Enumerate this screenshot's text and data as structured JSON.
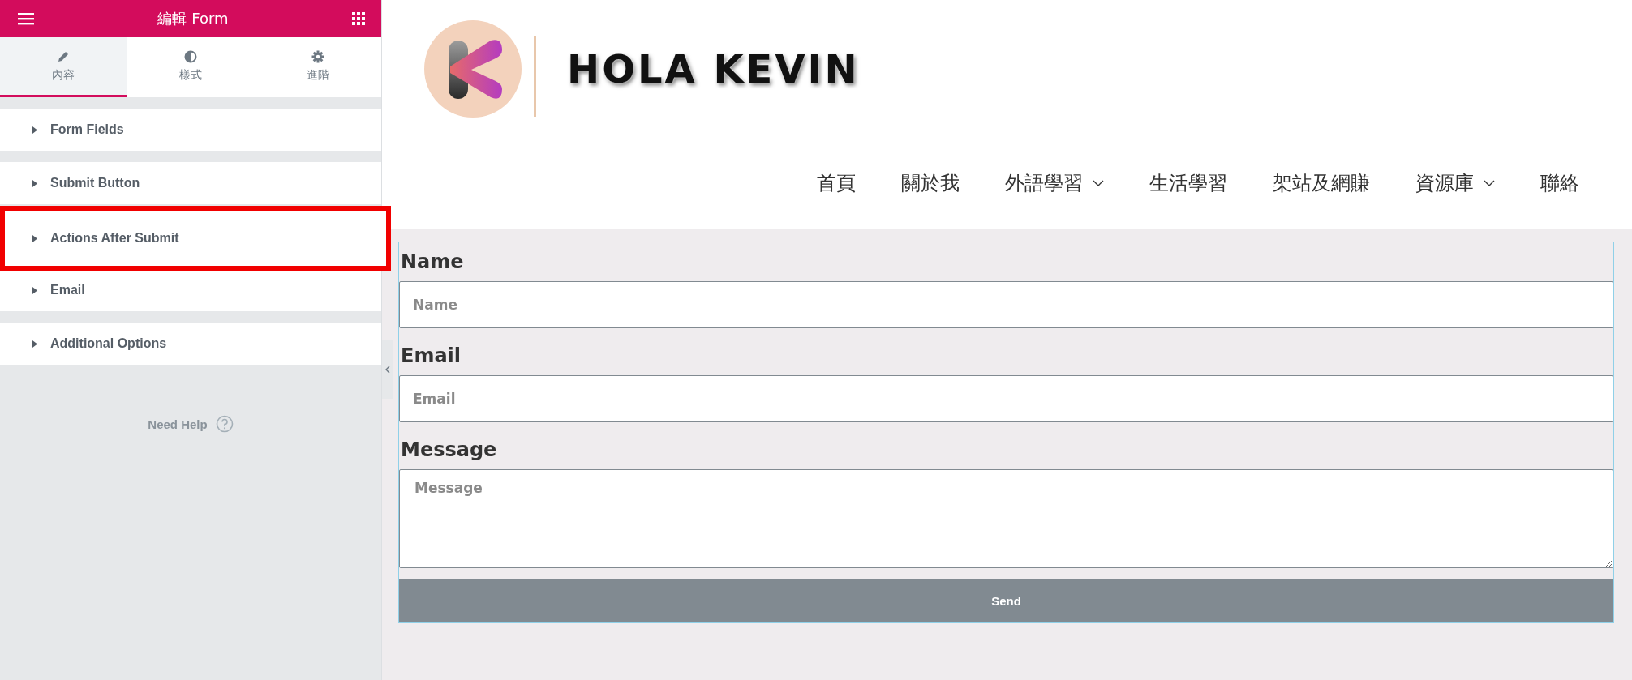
{
  "editor": {
    "title": "編輯 Form",
    "tabs": [
      {
        "label": "內容",
        "selected": true
      },
      {
        "label": "樣式",
        "selected": false
      },
      {
        "label": "進階",
        "selected": false
      }
    ],
    "sections": [
      {
        "label": "Form Fields",
        "highlighted": false
      },
      {
        "label": "Submit Button",
        "highlighted": false
      },
      {
        "label": "Actions After Submit",
        "highlighted": true
      },
      {
        "label": "Email",
        "highlighted": false
      },
      {
        "label": "Additional Options",
        "highlighted": false
      }
    ],
    "help": "Need Help"
  },
  "site": {
    "logo_text": "HOLA KEVIN",
    "nav": [
      {
        "label": "首頁",
        "has_dropdown": false
      },
      {
        "label": "關於我",
        "has_dropdown": false
      },
      {
        "label": "外語學習",
        "has_dropdown": true
      },
      {
        "label": "生活學習",
        "has_dropdown": false
      },
      {
        "label": "架站及網賺",
        "has_dropdown": false
      },
      {
        "label": "資源庫",
        "has_dropdown": true
      },
      {
        "label": "聯絡",
        "has_dropdown": false
      }
    ]
  },
  "form": {
    "fields": [
      {
        "label": "Name",
        "placeholder": "Name",
        "kind": "text"
      },
      {
        "label": "Email",
        "placeholder": "Email",
        "kind": "text"
      },
      {
        "label": "Message",
        "placeholder": "Message",
        "kind": "textarea"
      }
    ],
    "submit": "Send"
  }
}
